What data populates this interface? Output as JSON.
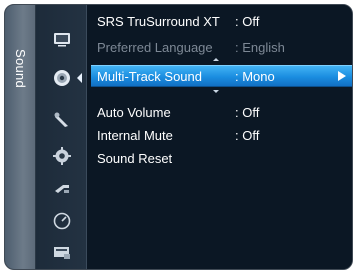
{
  "sidebar": {
    "title": "Sound",
    "icons": [
      {
        "name": "picture-icon"
      },
      {
        "name": "sound-icon"
      },
      {
        "name": "channel-icon"
      },
      {
        "name": "setup-icon"
      },
      {
        "name": "input-icon"
      },
      {
        "name": "application-icon"
      },
      {
        "name": "support-icon"
      }
    ],
    "active_index": 1
  },
  "menu": {
    "items": [
      {
        "label": "SRS TruSurround XT",
        "value": ": Off",
        "state": "normal"
      },
      {
        "label": "Preferred Language",
        "value": ": English",
        "state": "disabled"
      },
      {
        "label": "Multi-Track Sound",
        "value": ": Mono",
        "state": "selected"
      },
      {
        "label": "Auto Volume",
        "value": ": Off",
        "state": "normal"
      },
      {
        "label": "Internal Mute",
        "value": ": Off",
        "state": "normal"
      },
      {
        "label": "Sound Reset",
        "value": "",
        "state": "normal"
      }
    ]
  },
  "colors": {
    "panel_bg": "#0d1a29",
    "highlight": "#1a8de0",
    "text": "#ffffff",
    "disabled_text": "#7d8895"
  }
}
